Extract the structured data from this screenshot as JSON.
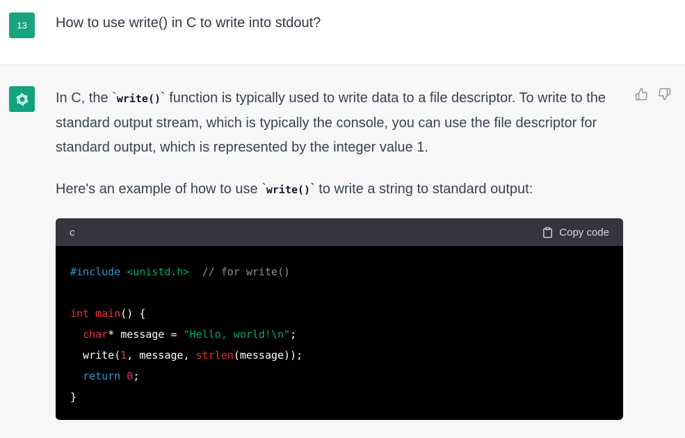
{
  "user": {
    "avatar_label": "13",
    "question": "How to use write() in C to write into stdout?"
  },
  "assistant": {
    "p1_a": "In C, the `",
    "p1_code": "write()",
    "p1_b": "` function is typically used to write data to a file descriptor. To write to the standard output stream, which is typically the console, you can use the file descriptor for standard output, which is represented by the integer value 1.",
    "p2_a": "Here's an example of how to use `",
    "p2_code": "write()",
    "p2_b": "` to write a string to standard output:"
  },
  "feedback": {
    "thumbs_up_icon": "thumbs-up-icon",
    "thumbs_down_icon": "thumbs-down-icon"
  },
  "code_block": {
    "language": "c",
    "copy_label": "Copy code",
    "lines": [
      [
        {
          "t": "#include ",
          "c": "kw"
        },
        {
          "t": "<unistd.h>",
          "c": "inc"
        },
        {
          "t": "  ",
          "c": "plain"
        },
        {
          "t": "// for write()",
          "c": "cmt"
        }
      ],
      [],
      [
        {
          "t": "int",
          "c": "type"
        },
        {
          "t": " ",
          "c": "plain"
        },
        {
          "t": "main",
          "c": "fn"
        },
        {
          "t": "() {",
          "c": "plain"
        }
      ],
      [
        {
          "t": "  ",
          "c": "plain"
        },
        {
          "t": "char",
          "c": "type"
        },
        {
          "t": "* message = ",
          "c": "plain"
        },
        {
          "t": "\"Hello, world!\\n\"",
          "c": "str"
        },
        {
          "t": ";",
          "c": "plain"
        }
      ],
      [
        {
          "t": "  write(",
          "c": "plain"
        },
        {
          "t": "1",
          "c": "num"
        },
        {
          "t": ", message, ",
          "c": "plain"
        },
        {
          "t": "strlen",
          "c": "fn"
        },
        {
          "t": "(message));",
          "c": "plain"
        }
      ],
      [
        {
          "t": "  ",
          "c": "plain"
        },
        {
          "t": "return",
          "c": "kw"
        },
        {
          "t": " ",
          "c": "plain"
        },
        {
          "t": "0",
          "c": "num"
        },
        {
          "t": ";",
          "c": "plain"
        }
      ],
      [
        {
          "t": "}",
          "c": "plain"
        }
      ]
    ]
  }
}
